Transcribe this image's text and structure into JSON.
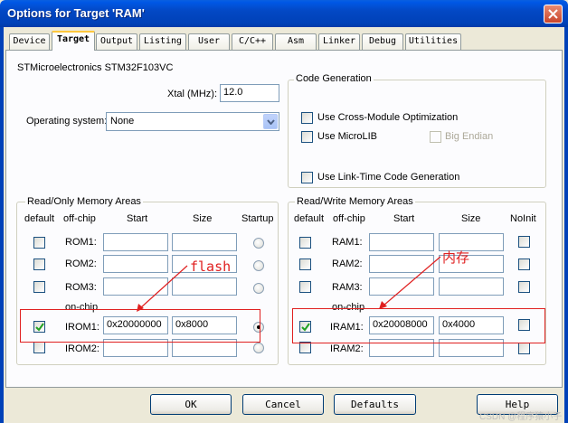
{
  "window": {
    "title": "Options for Target 'RAM'"
  },
  "tabs": [
    "Device",
    "Target",
    "Output",
    "Listing",
    "User",
    "C/C++",
    "Asm",
    "Linker",
    "Debug",
    "Utilities"
  ],
  "device_name": "STMicroelectronics STM32F103VC",
  "xtal": {
    "label": "Xtal (MHz):",
    "value": "12.0"
  },
  "os": {
    "label": "Operating system:",
    "value": "None"
  },
  "code_gen": {
    "title": "Code Generation",
    "cross_module": "Use Cross-Module Optimization",
    "microlib": "Use MicroLIB",
    "big_endian": "Big Endian",
    "link_time": "Use Link-Time Code Generation"
  },
  "ro_mem": {
    "title": "Read/Only Memory Areas",
    "headers": {
      "default": "default",
      "offchip": "off-chip",
      "start": "Start",
      "size": "Size",
      "startup": "Startup"
    },
    "onchip_label": "on-chip",
    "rows": [
      {
        "label": "ROM1:",
        "start": "",
        "size": "",
        "default": false,
        "startup": false
      },
      {
        "label": "ROM2:",
        "start": "",
        "size": "",
        "default": false,
        "startup": false
      },
      {
        "label": "ROM3:",
        "start": "",
        "size": "",
        "default": false,
        "startup": false
      },
      {
        "label": "IROM1:",
        "start": "0x20000000",
        "size": "0x8000",
        "default": true,
        "startup": true
      },
      {
        "label": "IROM2:",
        "start": "",
        "size": "",
        "default": false,
        "startup": false
      }
    ]
  },
  "rw_mem": {
    "title": "Read/Write Memory Areas",
    "headers": {
      "default": "default",
      "offchip": "off-chip",
      "start": "Start",
      "size": "Size",
      "noinit": "NoInit"
    },
    "onchip_label": "on-chip",
    "rows": [
      {
        "label": "RAM1:",
        "start": "",
        "size": "",
        "default": false,
        "noinit": false
      },
      {
        "label": "RAM2:",
        "start": "",
        "size": "",
        "default": false,
        "noinit": false
      },
      {
        "label": "RAM3:",
        "start": "",
        "size": "",
        "default": false,
        "noinit": false
      },
      {
        "label": "IRAM1:",
        "start": "0x20008000",
        "size": "0x4000",
        "default": true,
        "noinit": false
      },
      {
        "label": "IRAM2:",
        "start": "",
        "size": "",
        "default": false,
        "noinit": false
      }
    ]
  },
  "annotations": {
    "flash": "flash",
    "ram": "内存"
  },
  "buttons": {
    "ok": "OK",
    "cancel": "Cancel",
    "defaults": "Defaults",
    "help": "Help"
  },
  "watermark": "CSDN @程序猿小子",
  "colors": {
    "title_bar": "#0041b8",
    "annotation": "#e02020",
    "panel": "#fcfcfe",
    "dialog": "#ece9d8"
  }
}
